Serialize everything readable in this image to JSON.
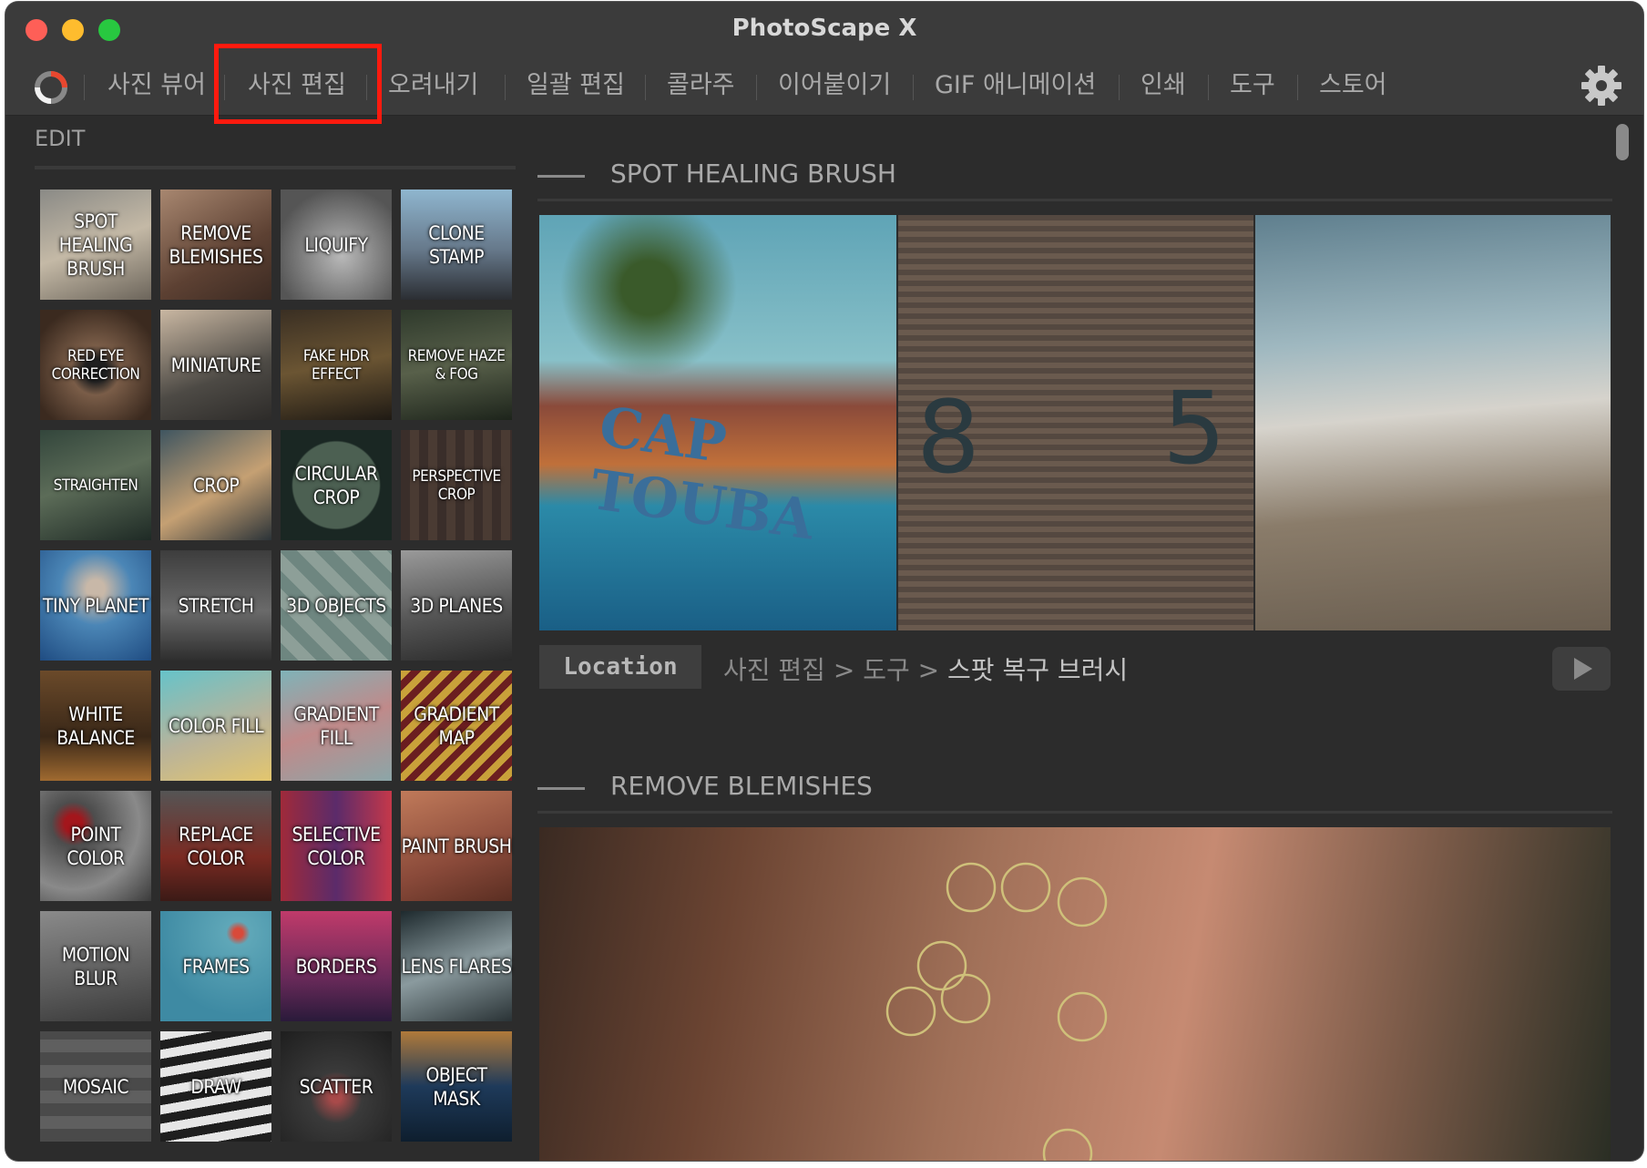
{
  "window": {
    "title": "PhotoScape X"
  },
  "menu": {
    "items": [
      "사진 뷰어",
      "사진 편집",
      "오려내기",
      "일괄 편집",
      "콜라주",
      "이어붙이기",
      "GIF 애니메이션",
      "인쇄",
      "도구",
      "스토어"
    ],
    "selected": "사진 편집",
    "highlight_color": "#ff1a0e"
  },
  "sidebar": {
    "heading": "EDIT",
    "tools": [
      "SPOT HEALING BRUSH",
      "REMOVE BLEMISHES",
      "LIQUIFY",
      "CLONE STAMP",
      "RED EYE CORRECTION",
      "MINIATURE",
      "FAKE HDR EFFECT",
      "REMOVE HAZE & FOG",
      "STRAIGHTEN",
      "CROP",
      "CIRCULAR CROP",
      "PERSPECTIVE CROP",
      "TINY PLANET",
      "STRETCH",
      "3D OBJECTS",
      "3D PLANES",
      "WHITE BALANCE",
      "COLOR FILL",
      "GRADIENT FILL",
      "GRADIENT MAP",
      "POINT COLOR",
      "REPLACE COLOR",
      "SELECTIVE COLOR",
      "PAINT BRUSH",
      "MOTION BLUR",
      "FRAMES",
      "BORDERS",
      "LENS FLARES",
      "MOSAIC",
      "DRAW",
      "SCATTER",
      "OBJECT MASK"
    ]
  },
  "content": {
    "section1": {
      "title": "SPOT HEALING BRUSH",
      "photo_text": [
        "CAP TOUBA",
        "8",
        "5"
      ],
      "location_label": "Location",
      "path_parts": [
        "사진 편집",
        ">",
        "도구",
        ">",
        "스팟 복구 브러시"
      ]
    },
    "section2": {
      "title": "REMOVE BLEMISHES"
    }
  },
  "icons": {
    "settings": "gear-icon",
    "logo": "app-logo-icon",
    "play": "play-icon"
  }
}
